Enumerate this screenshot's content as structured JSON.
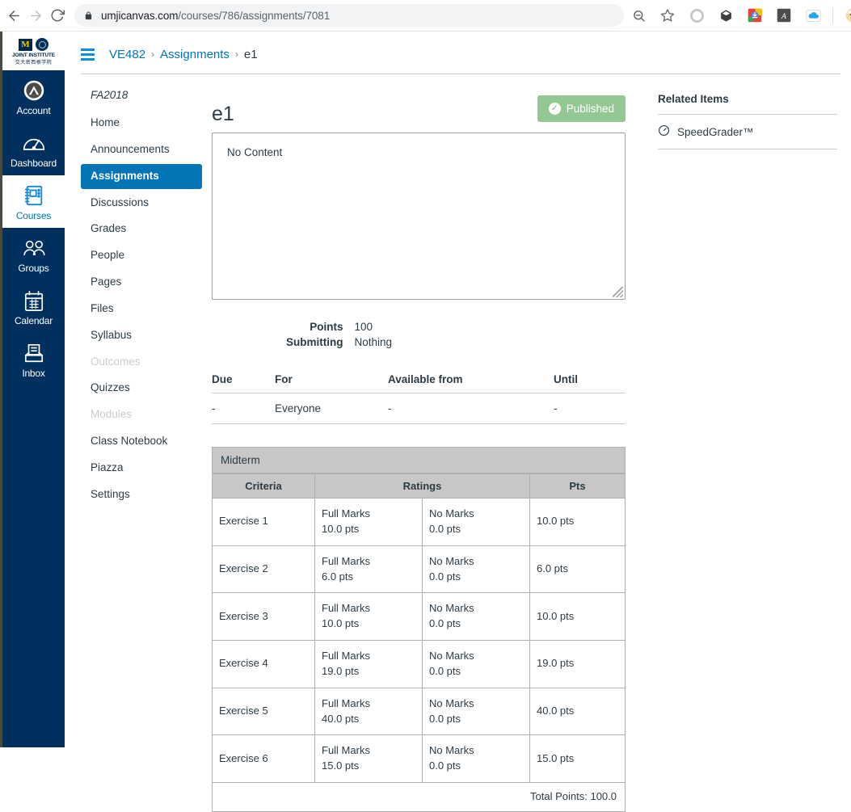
{
  "browser": {
    "url_host": "umjicanvas.com",
    "url_path": "/courses/786/assignments/7081",
    "back_icon": "back-arrow-icon",
    "forward_icon": "forward-arrow-icon",
    "reload_icon": "reload-icon",
    "lock_icon": "lock-icon",
    "zoom_icon": "zoom-out-icon",
    "bookmark_icon": "star-icon",
    "extensions": [
      "circle-extension-icon",
      "cube-extension-icon",
      "chrome-download-icon",
      "translate-icon",
      "onedrive-icon"
    ],
    "profile_icon": "profile-avatar-icon",
    "menu_icon": "three-dot-menu-icon"
  },
  "global_nav": {
    "logo": {
      "m_mark": "M",
      "line1": "JOINT INSTITUTE",
      "line2": "交大密西根学院"
    },
    "items": [
      {
        "label": "Account",
        "icon": "account-avatar-icon",
        "active": false
      },
      {
        "label": "Dashboard",
        "icon": "dashboard-icon",
        "active": false
      },
      {
        "label": "Courses",
        "icon": "courses-book-icon",
        "active": true
      },
      {
        "label": "Groups",
        "icon": "groups-people-icon",
        "active": false
      },
      {
        "label": "Calendar",
        "icon": "calendar-icon",
        "active": false
      },
      {
        "label": "Inbox",
        "icon": "inbox-tray-icon",
        "active": false
      }
    ]
  },
  "course_nav": {
    "term": "FA2018",
    "items": [
      {
        "label": "Home",
        "state": "normal"
      },
      {
        "label": "Announcements",
        "state": "normal"
      },
      {
        "label": "Assignments",
        "state": "active"
      },
      {
        "label": "Discussions",
        "state": "normal"
      },
      {
        "label": "Grades",
        "state": "normal"
      },
      {
        "label": "People",
        "state": "normal"
      },
      {
        "label": "Pages",
        "state": "normal"
      },
      {
        "label": "Files",
        "state": "normal"
      },
      {
        "label": "Syllabus",
        "state": "normal"
      },
      {
        "label": "Outcomes",
        "state": "muted"
      },
      {
        "label": "Quizzes",
        "state": "normal"
      },
      {
        "label": "Modules",
        "state": "muted"
      },
      {
        "label": "Class Notebook",
        "state": "normal"
      },
      {
        "label": "Piazza",
        "state": "normal"
      },
      {
        "label": "Settings",
        "state": "normal"
      }
    ]
  },
  "breadcrumb": {
    "menu_icon": "hamburger-menu-icon",
    "course": "VE482",
    "section": "Assignments",
    "current": "e1",
    "separator": "›"
  },
  "assignment": {
    "title": "e1",
    "publish_label": "Published",
    "publish_icon": "check-circle-icon",
    "publish_color": "#94c794",
    "description": "No Content",
    "meta": [
      {
        "label": "Points",
        "value": "100"
      },
      {
        "label": "Submitting",
        "value": "Nothing"
      }
    ],
    "due_table": {
      "headers": [
        "Due",
        "For",
        "Available from",
        "Until"
      ],
      "rows": [
        [
          "-",
          "Everyone",
          "-",
          "-"
        ]
      ]
    }
  },
  "rubric": {
    "name": "Midterm",
    "headers": [
      "Criteria",
      "Ratings",
      "Pts"
    ],
    "rows": [
      {
        "criteria": "Exercise 1",
        "rating_full": "Full Marks",
        "rating_full_pts": "10.0 pts",
        "rating_none": "No Marks",
        "rating_none_pts": "0.0 pts",
        "pts": "10.0 pts"
      },
      {
        "criteria": "Exercise 2",
        "rating_full": "Full Marks",
        "rating_full_pts": "6.0 pts",
        "rating_none": "No Marks",
        "rating_none_pts": "0.0 pts",
        "pts": "6.0 pts"
      },
      {
        "criteria": "Exercise 3",
        "rating_full": "Full Marks",
        "rating_full_pts": "10.0 pts",
        "rating_none": "No Marks",
        "rating_none_pts": "0.0 pts",
        "pts": "10.0 pts"
      },
      {
        "criteria": "Exercise 4",
        "rating_full": "Full Marks",
        "rating_full_pts": "19.0 pts",
        "rating_none": "No Marks",
        "rating_none_pts": "0.0 pts",
        "pts": "19.0 pts"
      },
      {
        "criteria": "Exercise 5",
        "rating_full": "Full Marks",
        "rating_full_pts": "40.0 pts",
        "rating_none": "No Marks",
        "rating_none_pts": "0.0 pts",
        "pts": "40.0 pts"
      },
      {
        "criteria": "Exercise 6",
        "rating_full": "Full Marks",
        "rating_full_pts": "15.0 pts",
        "rating_none": "No Marks",
        "rating_none_pts": "0.0 pts",
        "pts": "15.0 pts"
      }
    ],
    "total": "Total Points: 100.0"
  },
  "related_items": {
    "title": "Related Items",
    "links": [
      {
        "label": "SpeedGrader™",
        "icon": "speedgrader-clock-icon"
      }
    ]
  }
}
